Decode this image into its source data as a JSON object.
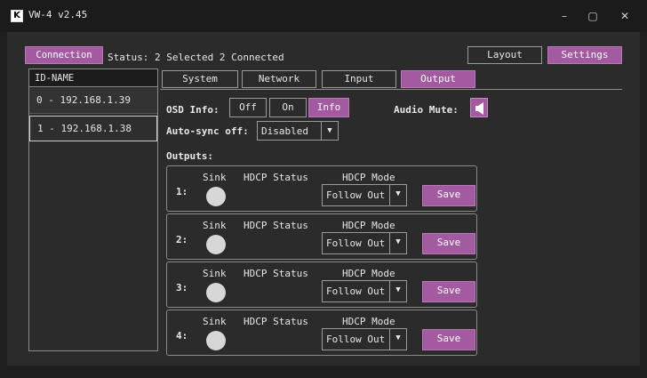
{
  "titlebar": {
    "logo": "K",
    "title": "VW-4 v2.45",
    "minimize": "–",
    "maximize": "▢",
    "close": "✕"
  },
  "top": {
    "connection": "Connection",
    "status": "Status: 2 Selected 2 Connected",
    "layout": "Layout",
    "settings": "Settings"
  },
  "list": {
    "header": "ID-NAME",
    "items": [
      {
        "label": "0 - 192.168.1.39"
      },
      {
        "label": "1 - 192.168.1.38"
      }
    ]
  },
  "tabs": [
    {
      "label": "System"
    },
    {
      "label": "Network"
    },
    {
      "label": "Input"
    },
    {
      "label": "Output",
      "active": true
    }
  ],
  "osd": {
    "label": "OSD Info:",
    "options": [
      "Off",
      "On",
      "Info"
    ],
    "selected": "Info"
  },
  "audio_mute": {
    "label": "Audio Mute:",
    "icon": "speaker-icon"
  },
  "autosync": {
    "label": "Auto-sync off:",
    "value": "Disabled"
  },
  "outputs": {
    "label": "Outputs:",
    "col_sink": "Sink",
    "col_hdcp_status": "HDCP Status",
    "col_hdcp_mode": "HDCP Mode",
    "rows": [
      {
        "num": "1:",
        "mode": "Follow Out",
        "save": "Save"
      },
      {
        "num": "2:",
        "mode": "Follow Out",
        "save": "Save"
      },
      {
        "num": "3:",
        "mode": "Follow Out",
        "save": "Save"
      },
      {
        "num": "4:",
        "mode": "Follow Out",
        "save": "Save"
      }
    ]
  },
  "colors": {
    "accent": "#a35aa1",
    "background": "#1f1f1f",
    "panel": "#2b2b2b"
  }
}
